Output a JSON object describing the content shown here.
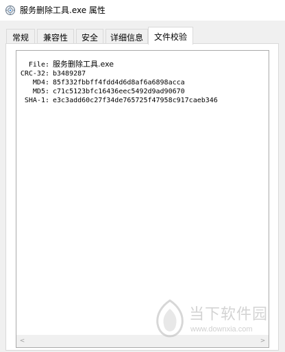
{
  "window": {
    "title": "服务删除工具.exe 属性"
  },
  "tabs": [
    {
      "label": "常规",
      "active": false
    },
    {
      "label": "兼容性",
      "active": false
    },
    {
      "label": "安全",
      "active": false
    },
    {
      "label": "详细信息",
      "active": false
    },
    {
      "label": "文件校验",
      "active": true
    }
  ],
  "file_check": {
    "rows": [
      {
        "label": "File:",
        "value": "服务删除工具.exe"
      },
      {
        "label": "CRC-32:",
        "value": "b3489287"
      },
      {
        "label": "MD4:",
        "value": "85f332fbbff4fdd4d6d8af6a6898acca"
      },
      {
        "label": "MD5:",
        "value": "c71c5123bfc16436eec5492d9ad90670"
      },
      {
        "label": "SHA-1:",
        "value": "e3c3add60c27f34de765725f47958c917caeb346"
      }
    ]
  },
  "scrollbar": {
    "left_arrow": "<",
    "right_arrow": ">"
  },
  "watermark": {
    "name": "当下软件园",
    "url": "www.downxia.com"
  },
  "colors": {
    "window_bg": "#f0f0f0",
    "titlebar_bg": "#ffffff",
    "panel_bg": "#ffffff",
    "border": "#d9d9d9",
    "textbox_border": "#a9a9a9",
    "watermark": "#b0b0b0"
  }
}
